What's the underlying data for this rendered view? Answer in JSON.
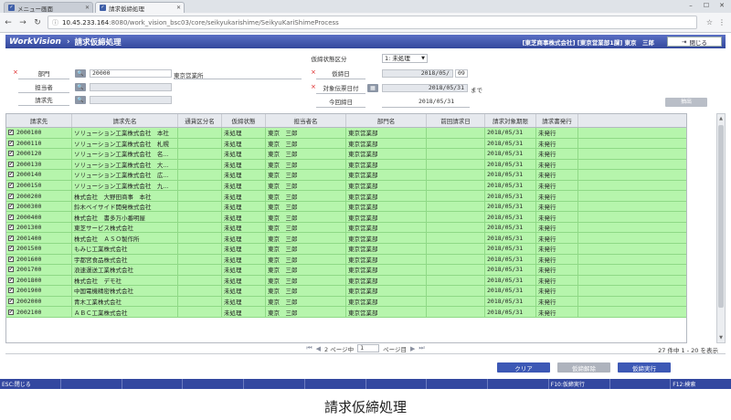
{
  "browser": {
    "tabs": [
      {
        "label": "メニュー画面",
        "active": false
      },
      {
        "label": "請求仮締処理",
        "active": true
      }
    ],
    "url_host": "10.45.233.164",
    "url_path": ":8080/work_vision_bsc03/core/seikyukarishime/SeikyuKariShimeProcess"
  },
  "header": {
    "logo": "WorkVision",
    "title": "請求仮締処理",
    "user_info": "[東芝商事株式会社] [東京営業部1課] 東京　三郎",
    "close_label": "閉じる"
  },
  "form": {
    "division_label": "仮締状態区分",
    "division_value": "1: 未処理",
    "dept_label": "部門",
    "dept_code": "20000",
    "dept_name": "東京営業所",
    "manager_label": "担当者",
    "billing_to_label": "請求先",
    "karishime_date_label": "仮締日",
    "karishime_date_value": "2018/05/",
    "karishime_date_day": "09",
    "target_date_label": "対象伝票日付",
    "target_date_value": "2018/05/31",
    "target_date_suffix": "まで",
    "last_close_label": "今回締日",
    "last_close_value": "2018/05/31",
    "output_btn": "抽出"
  },
  "grid": {
    "headers": [
      "請求先",
      "請求先名",
      "通貨区分名",
      "仮締状態",
      "担当者名",
      "部門名",
      "前回請求日",
      "請求対象期限",
      "請求書発行"
    ],
    "rows": [
      {
        "code": "2000100",
        "name": "ソリューション工業株式会社　本社",
        "status": "未処理",
        "manager": "東京　三郎",
        "dept": "東京営業部",
        "due": "2018/05/31",
        "issue": "未発行"
      },
      {
        "code": "2000110",
        "name": "ソリューション工業株式会社　札幌",
        "status": "未処理",
        "manager": "東京　三郎",
        "dept": "東京営業部",
        "due": "2018/05/31",
        "issue": "未発行"
      },
      {
        "code": "2000120",
        "name": "ソリューション工業株式会社　名...",
        "status": "未処理",
        "manager": "東京　三郎",
        "dept": "東京営業部",
        "due": "2018/05/31",
        "issue": "未発行"
      },
      {
        "code": "2000130",
        "name": "ソリューション工業株式会社　大...",
        "status": "未処理",
        "manager": "東京　三郎",
        "dept": "東京営業部",
        "due": "2018/05/31",
        "issue": "未発行"
      },
      {
        "code": "2000140",
        "name": "ソリューション工業株式会社　広...",
        "status": "未処理",
        "manager": "東京　三郎",
        "dept": "東京営業部",
        "due": "2018/05/31",
        "issue": "未発行"
      },
      {
        "code": "2000150",
        "name": "ソリューション工業株式会社　九...",
        "status": "未処理",
        "manager": "東京　三郎",
        "dept": "東京営業部",
        "due": "2018/05/31",
        "issue": "未発行"
      },
      {
        "code": "2000200",
        "name": "株式会社　大野田商事　本社",
        "status": "未処理",
        "manager": "東京　三郎",
        "dept": "東京営業部",
        "due": "2018/05/31",
        "issue": "未発行"
      },
      {
        "code": "2000300",
        "name": "鈴木ベイサイド開発株式会社",
        "status": "未処理",
        "manager": "東京　三郎",
        "dept": "東京営業部",
        "due": "2018/05/31",
        "issue": "未発行"
      },
      {
        "code": "2000400",
        "name": "株式会社　書多万小番明屋",
        "status": "未処理",
        "manager": "東京　三郎",
        "dept": "東京営業部",
        "due": "2018/05/31",
        "issue": "未発行"
      },
      {
        "code": "2001300",
        "name": "東芝サービス株式会社",
        "status": "未処理",
        "manager": "東京　三郎",
        "dept": "東京営業部",
        "due": "2018/05/31",
        "issue": "未発行"
      },
      {
        "code": "2001400",
        "name": "株式会社　ＡＳＯ製作所",
        "status": "未処理",
        "manager": "東京　三郎",
        "dept": "東京営業部",
        "due": "2018/05/31",
        "issue": "未発行"
      },
      {
        "code": "2001500",
        "name": "もみじ工業株式会社",
        "status": "未処理",
        "manager": "東京　三郎",
        "dept": "東京営業部",
        "due": "2018/05/31",
        "issue": "未発行"
      },
      {
        "code": "2001600",
        "name": "宇都宮食品株式会社",
        "status": "未処理",
        "manager": "東京　三郎",
        "dept": "東京営業部",
        "due": "2018/05/31",
        "issue": "未発行"
      },
      {
        "code": "2001700",
        "name": "浪速運送工業株式会社",
        "status": "未処理",
        "manager": "東京　三郎",
        "dept": "東京営業部",
        "due": "2018/05/31",
        "issue": "未発行"
      },
      {
        "code": "2001800",
        "name": "株式会社　デモ社",
        "status": "未処理",
        "manager": "東京　三郎",
        "dept": "東京営業部",
        "due": "2018/05/31",
        "issue": "未発行"
      },
      {
        "code": "2001900",
        "name": "中国電機精密株式会社",
        "status": "未処理",
        "manager": "東京　三郎",
        "dept": "東京営業部",
        "due": "2018/05/31",
        "issue": "未発行"
      },
      {
        "code": "2002000",
        "name": "青木工業株式会社",
        "status": "未処理",
        "manager": "東京　三郎",
        "dept": "東京営業部",
        "due": "2018/05/31",
        "issue": "未発行"
      },
      {
        "code": "2002100",
        "name": "ＡＢＣ工業株式会社",
        "status": "未処理",
        "manager": "東京　三郎",
        "dept": "東京営業部",
        "due": "2018/05/31",
        "issue": "未発行"
      }
    ]
  },
  "pager": {
    "page_value": "1",
    "total_pages_label": "2 ページ中",
    "page_suffix": "ページ目",
    "count_label": "27 件中 1 - 20 を表示"
  },
  "actions": {
    "clear": "クリア",
    "cancel": "仮締解除",
    "execute": "仮締実行"
  },
  "fkeys": [
    "ESC:閉じる",
    "",
    "",
    "",
    "",
    "",
    "",
    "",
    "",
    "F10:仮締実行",
    "",
    "F12:検索"
  ],
  "caption": "請求仮締処理",
  "colors": {
    "header_blue": "#3348a0",
    "row_green": "#b6f5ac",
    "required_red": "#d22222"
  }
}
